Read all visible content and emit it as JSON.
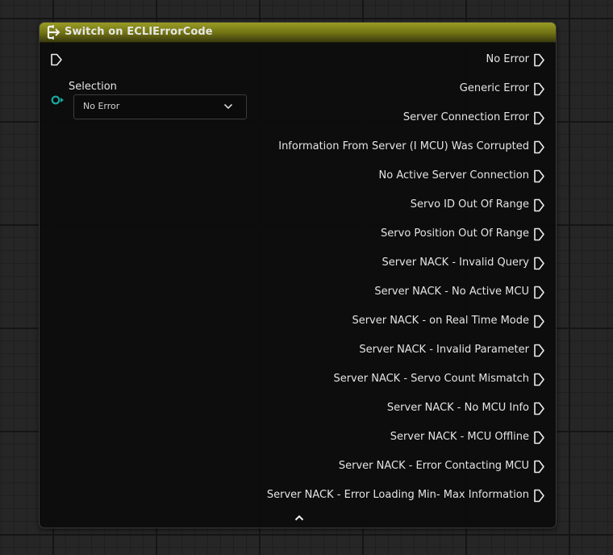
{
  "node": {
    "title": "Switch on ECLIErrorCode",
    "header_color": "#8f9120",
    "selection_label": "Selection",
    "selection_value": "No Error",
    "pin_color_selection": "#1aa8a0",
    "outputs": [
      "No Error",
      "Generic Error",
      "Server Connection Error",
      "Information From Server (I MCU) Was Corrupted",
      "No Active Server Connection",
      "Servo ID Out Of Range",
      "Servo Position Out Of Range",
      "Server NACK - Invalid Query",
      "Server NACK - No Active MCU",
      "Server NACK - on Real Time Mode",
      "Server NACK - Invalid Parameter",
      "Server NACK - Servo Count Mismatch",
      "Server NACK - No MCU Info",
      "Server NACK - MCU Offline",
      "Server NACK - Error Contacting MCU",
      "Server NACK - Error Loading Min- Max Information"
    ],
    "icons": {
      "header": "switch-icon",
      "exec_input": "exec-pin-icon",
      "selection_pin": "data-pin-icon",
      "dropdown": "chevron-down-icon",
      "collapse": "chevron-up-icon"
    }
  }
}
